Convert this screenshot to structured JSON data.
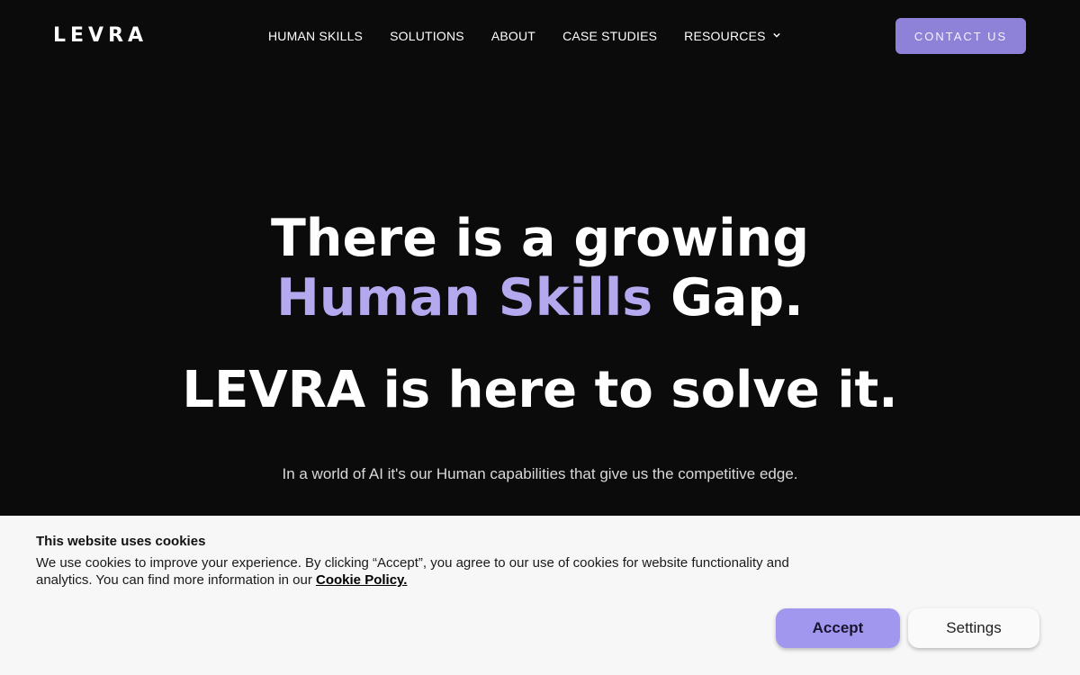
{
  "brand": {
    "logo": "LEVRA"
  },
  "nav": {
    "items": [
      {
        "label": "HUMAN SKILLS"
      },
      {
        "label": "SOLUTIONS"
      },
      {
        "label": "ABOUT"
      },
      {
        "label": "CASE STUDIES"
      },
      {
        "label": "RESOURCES",
        "has_dropdown": true
      }
    ],
    "contact_label": "CONTACT US"
  },
  "hero": {
    "line1": "There is a growing",
    "line2_accent": "Human Skills",
    "line2_rest": " Gap.",
    "line3": "LEVRA is here to solve it.",
    "subtitle": "In a world of AI it's our Human capabilities that give us the competitive edge."
  },
  "cookie_banner": {
    "title": "This website uses cookies",
    "text": "We use cookies to improve your experience. By clicking “Accept”, you agree to our use of cookies for website functionality and analytics. You can find more information in our ",
    "link_label": "Cookie Policy.",
    "accept_label": "Accept",
    "settings_label": "Settings"
  },
  "colors": {
    "background": "#0c0b0c",
    "accent": "#b4a8ee",
    "button": "#8e81d8",
    "accept_button": "#a197ee",
    "banner": "#f7f7f7"
  },
  "icons": {
    "resources_dropdown": "chevron-down-icon"
  }
}
